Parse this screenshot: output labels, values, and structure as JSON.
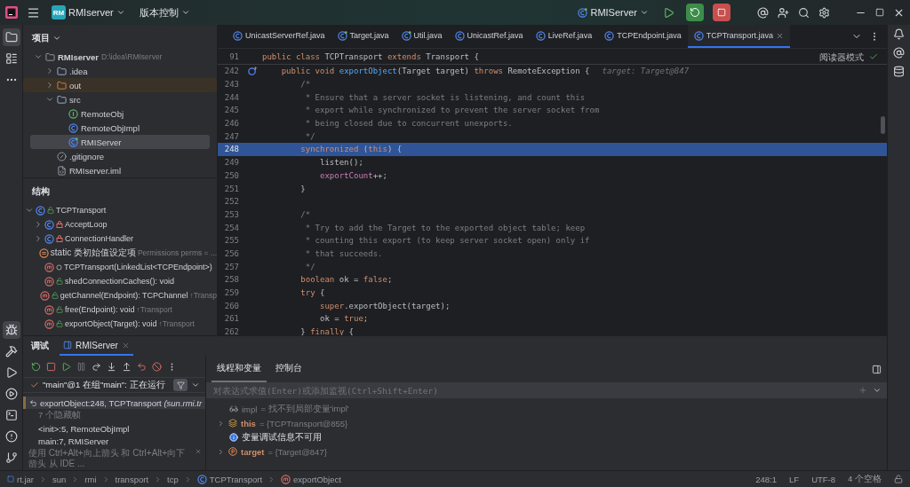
{
  "title_bar": {
    "project_badge": "RM",
    "project": "RMIserver",
    "vcs": "版本控制",
    "run_config": "RMIServer"
  },
  "left_toolbar": [
    {
      "kind": "project",
      "selected": true
    },
    {
      "kind": "structure",
      "selected": false
    },
    {
      "kind": "more",
      "selected": false
    }
  ],
  "left_toolbar_bottom": [
    {
      "kind": "debug",
      "selected": true
    },
    {
      "kind": "build",
      "selected": false
    },
    {
      "kind": "run",
      "selected": false
    },
    {
      "kind": "services",
      "selected": false
    },
    {
      "kind": "terminal",
      "selected": false
    },
    {
      "kind": "problems",
      "selected": false
    },
    {
      "kind": "git",
      "selected": false
    }
  ],
  "project": {
    "title": "项目",
    "tree": [
      {
        "label": "RMIserver",
        "kind": "module",
        "path": "D:\\idea\\RMIserver",
        "expanded": true,
        "selected": false,
        "children": [
          {
            "label": ".idea",
            "kind": "folder",
            "expanded": false,
            "selected": false
          },
          {
            "label": "out",
            "kind": "excluded_folder",
            "expanded": false,
            "selected": false
          },
          {
            "label": "src",
            "kind": "folder",
            "expanded": true,
            "selected": false,
            "children": [
              {
                "label": "RemoteObj",
                "kind": "interface",
                "selected": false
              },
              {
                "label": "RemoteObjImpl",
                "kind": "class",
                "selected": false
              },
              {
                "label": "RMIServer",
                "kind": "main_class",
                "selected": true
              }
            ]
          },
          {
            "label": ".gitignore",
            "kind": "ignore_file",
            "selected": false
          },
          {
            "label": "RMIserver.iml",
            "kind": "module_file",
            "selected": false
          }
        ]
      }
    ]
  },
  "structure": {
    "title": "结构",
    "tree": [
      {
        "label": "TCPTransport",
        "kind": "public_class",
        "expanded": true,
        "children": [
          {
            "label": "AcceptLoop",
            "kind": "private_class",
            "expanded": false
          },
          {
            "label": "ConnectionHandler",
            "kind": "private_class",
            "expanded": false
          },
          {
            "label": "static 类初始值设定项",
            "kind": "static_init",
            "hint": "Permissions perms = ..."
          },
          {
            "label": "TCPTransport(LinkedList<TCPEndpoint>)",
            "kind": "package_method"
          },
          {
            "label": "shedConnectionCaches(): void",
            "kind": "public_method"
          },
          {
            "label": "getChannel(Endpoint): TCPChannel",
            "kind": "public_method",
            "hint": "↑Transp"
          },
          {
            "label": "free(Endpoint): void",
            "kind": "public_method",
            "hint": "↑Transport"
          },
          {
            "label": "exportObject(Target): void",
            "kind": "public_method",
            "hint": "↑Transport"
          }
        ]
      }
    ]
  },
  "editor": {
    "tabs": [
      {
        "label": "UnicastServerRef.java",
        "kind": "class",
        "selected": false
      },
      {
        "label": "Target.java",
        "kind": "compiled_class",
        "selected": false
      },
      {
        "label": "Util.java",
        "kind": "compiled_class",
        "selected": false
      },
      {
        "label": "UnicastRef.java",
        "kind": "class",
        "selected": false
      },
      {
        "label": "LiveRef.java",
        "kind": "class",
        "selected": false
      },
      {
        "label": "TCPEndpoint.java",
        "kind": "class",
        "selected": false
      },
      {
        "label": "TCPTransport.java",
        "kind": "class",
        "selected": true
      }
    ],
    "reader_mode": "阅读器模式",
    "sticky_line": {
      "number": "91",
      "tokens": [
        {
          "kind": "keyword",
          "text": "public class "
        },
        {
          "kind": "plain",
          "text": "TCPTransport "
        },
        {
          "kind": "keyword",
          "text": "extends "
        },
        {
          "kind": "plain",
          "text": "Transport {"
        }
      ]
    },
    "lines": [
      {
        "number": "242",
        "selected": false,
        "override_marker": true,
        "tokens": [
          {
            "kind": "keyword",
            "text": "    public void "
          },
          {
            "kind": "method",
            "text": "exportObject"
          },
          {
            "kind": "plain",
            "text": "(Target target) "
          },
          {
            "kind": "keyword",
            "text": "throws "
          },
          {
            "kind": "plain",
            "text": "RemoteException {"
          },
          {
            "kind": "hint",
            "text": "target: Target@847"
          }
        ]
      },
      {
        "number": "243",
        "selected": false,
        "tokens": [
          {
            "kind": "comment",
            "text": "        /*"
          }
        ]
      },
      {
        "number": "244",
        "selected": false,
        "tokens": [
          {
            "kind": "comment",
            "text": "         * Ensure that a server socket is listening, and count this"
          }
        ]
      },
      {
        "number": "245",
        "selected": false,
        "tokens": [
          {
            "kind": "comment",
            "text": "         * export while synchronized to prevent the server socket from"
          }
        ]
      },
      {
        "number": "246",
        "selected": false,
        "tokens": [
          {
            "kind": "comment",
            "text": "         * being closed due to concurrent unexports."
          }
        ]
      },
      {
        "number": "247",
        "selected": false,
        "tokens": [
          {
            "kind": "comment",
            "text": "         */"
          }
        ]
      },
      {
        "number": "248",
        "selected": true,
        "tokens": [
          {
            "kind": "keyword",
            "text": "        synchronized "
          },
          {
            "kind": "plain",
            "text": "("
          },
          {
            "kind": "keyword",
            "text": "this"
          },
          {
            "kind": "plain",
            "text": ") {"
          }
        ]
      },
      {
        "number": "249",
        "selected": false,
        "tokens": [
          {
            "kind": "plain",
            "text": "            listen();"
          }
        ]
      },
      {
        "number": "250",
        "selected": false,
        "tokens": [
          {
            "kind": "field",
            "text": "            exportCount"
          },
          {
            "kind": "plain",
            "text": "++;"
          }
        ]
      },
      {
        "number": "251",
        "selected": false,
        "tokens": [
          {
            "kind": "plain",
            "text": "        }"
          }
        ]
      },
      {
        "number": "252",
        "selected": false
      },
      {
        "number": "253",
        "selected": false,
        "tokens": [
          {
            "kind": "comment",
            "text": "        /*"
          }
        ]
      },
      {
        "number": "254",
        "selected": false,
        "tokens": [
          {
            "kind": "comment",
            "text": "         * Try to add the Target to the exported object table; keep"
          }
        ]
      },
      {
        "number": "255",
        "selected": false,
        "tokens": [
          {
            "kind": "comment",
            "text": "         * counting this export (to keep server socket open) only if"
          }
        ]
      },
      {
        "number": "256",
        "selected": false,
        "tokens": [
          {
            "kind": "comment",
            "text": "         * that succeeds."
          }
        ]
      },
      {
        "number": "257",
        "selected": false,
        "tokens": [
          {
            "kind": "comment",
            "text": "         */"
          }
        ]
      },
      {
        "number": "258",
        "selected": false,
        "tokens": [
          {
            "kind": "keyword",
            "text": "        boolean "
          },
          {
            "kind": "plain",
            "text": "ok = "
          },
          {
            "kind": "keyword",
            "text": "false"
          },
          {
            "kind": "plain",
            "text": ";"
          }
        ]
      },
      {
        "number": "259",
        "selected": false,
        "tokens": [
          {
            "kind": "keyword",
            "text": "        try "
          },
          {
            "kind": "plain",
            "text": "{"
          }
        ]
      },
      {
        "number": "260",
        "selected": false,
        "tokens": [
          {
            "kind": "keyword",
            "text": "            super"
          },
          {
            "kind": "plain",
            "text": ".exportObject(target);"
          }
        ]
      },
      {
        "number": "261",
        "selected": false,
        "tokens": [
          {
            "kind": "plain",
            "text": "            ok = "
          },
          {
            "kind": "keyword",
            "text": "true"
          },
          {
            "kind": "plain",
            "text": ";"
          }
        ]
      },
      {
        "number": "262",
        "selected": false,
        "tokens": [
          {
            "kind": "plain",
            "text": "        } "
          },
          {
            "kind": "keyword",
            "text": "finally "
          },
          {
            "kind": "plain",
            "text": "{"
          }
        ]
      }
    ]
  },
  "debug": {
    "title": "调试",
    "tabs": [
      {
        "label": "RMIServer",
        "selected": true
      }
    ],
    "thread": "\"main\"@1 在组\"main\": 正在运行",
    "frames": [
      {
        "text": "exportObject:248, TCPTransport *(sun.rmi.tr*",
        "kind": "current",
        "selected": true
      },
      {
        "text": "7 个隐藏帧",
        "kind": "hidden",
        "selected": false
      },
      {
        "text": "<init>:5, RemoteObjImpl",
        "kind": "frame",
        "selected": false
      },
      {
        "text": "main:7, RMIServer",
        "kind": "frame",
        "selected": false
      }
    ],
    "frames_hint": "使用 Ctrl+Alt+向上箭头 和 Ctrl+Alt+向下箭头 从 IDE ...",
    "view_tabs": [
      {
        "label": "线程和变量",
        "selected": true
      },
      {
        "label": "控制台",
        "selected": false
      }
    ],
    "evaluate_placeholder": "对表达式求值(Enter)或添加监视(Ctrl+Shift+Enter)",
    "variables": [
      {
        "kind": "watch",
        "name": "impl",
        "value": "= 找不到局部变量'impl'"
      },
      {
        "kind": "object",
        "name": "this",
        "value": "= {TCPTransport@855}",
        "expanded": false
      },
      {
        "kind": "info",
        "name": "变量调试信息不可用"
      },
      {
        "kind": "parameter",
        "name": "target",
        "value": "= {Target@847}",
        "expanded": false
      }
    ]
  },
  "status_bar": {
    "breadcrumbs": [
      {
        "label": "rt.jar",
        "kind": "jar"
      },
      {
        "label": "sun",
        "kind": "package"
      },
      {
        "label": "rmi",
        "kind": "package"
      },
      {
        "label": "transport",
        "kind": "package"
      },
      {
        "label": "tcp",
        "kind": "package"
      },
      {
        "label": "TCPTransport",
        "kind": "class"
      },
      {
        "label": "exportObject",
        "kind": "method"
      }
    ],
    "position": "248:1",
    "line_separator": "LF",
    "encoding": "UTF-8",
    "indent": "4 个空格"
  }
}
